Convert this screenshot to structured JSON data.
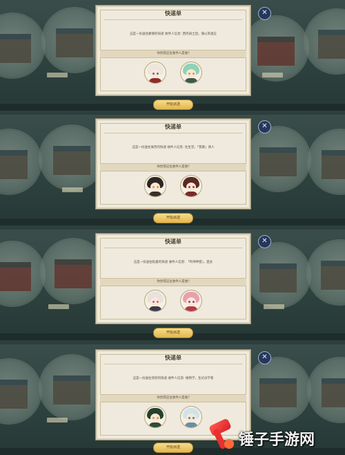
{
  "panels": [
    {
      "title": "快递单",
      "description": "这是一份送往蒙德的快递 收件人信息: 西风骑士团，蒲公英酒庄",
      "question": "你觉得这位收件人是谁?",
      "start_label": "开始派送",
      "close_glyph": "✕",
      "candidates": [
        {
          "name": "candidate-white-hair",
          "hair": "#ece6dc",
          "outfit": "#8f2b2b",
          "eyes": "#5a6fa8"
        },
        {
          "name": "candidate-green-hair",
          "hair": "#8fd3b6",
          "outfit": "#3c5a4a",
          "eyes": "#c9a14a"
        }
      ]
    },
    {
      "title": "快递单",
      "description": "这是一份送往璃月的快递 收件人信息: 往生堂，「客卿」请人",
      "question": "你觉得这位收件人是谁?",
      "start_label": "开始派送",
      "close_glyph": "✕",
      "candidates": [
        {
          "name": "candidate-dark-hair",
          "hair": "#2e2622",
          "outfit": "#3a2f28",
          "eyes": "#c9a14a"
        },
        {
          "name": "candidate-hat-brown",
          "hair": "#5a2a24",
          "outfit": "#7a2a2a",
          "eyes": "#b23a3a"
        }
      ]
    },
    {
      "title": "快递单",
      "description": "这是一份送往稻妻的快递 收件人信息: 「鸣神神使」，巫女",
      "question": "你觉得这位收件人是谁?",
      "start_label": "开始派送",
      "close_glyph": "✕",
      "candidates": [
        {
          "name": "candidate-silver-hair",
          "hair": "#e8e2dc",
          "outfit": "#3a3a4a",
          "eyes": "#b06a8a"
        },
        {
          "name": "candidate-pink-hair",
          "hair": "#e9a0ac",
          "outfit": "#b43a4a",
          "eyes": "#7a4a8a"
        }
      ]
    },
    {
      "title": "快递单",
      "description": "这是一份送往须弥的快递 收件人信息: 植物学，生论派学者",
      "question": "你觉得这位收件人是谁?",
      "start_label": "开始派送",
      "close_glyph": "✕",
      "candidates": [
        {
          "name": "candidate-dark-green",
          "hair": "#27402e",
          "outfit": "#2e4a38",
          "eyes": "#c9a14a"
        },
        {
          "name": "candidate-light-blue",
          "hair": "#cfe4ea",
          "outfit": "#6a8fa0",
          "eyes": "#3a8a8a"
        }
      ]
    }
  ],
  "watermark": {
    "text": "锤子手游网",
    "icon": "hammer-logo-icon"
  },
  "colors": {
    "accent": "#e3b64f",
    "close_bg": "#26385a",
    "dialog_bg": "#efeadd"
  }
}
